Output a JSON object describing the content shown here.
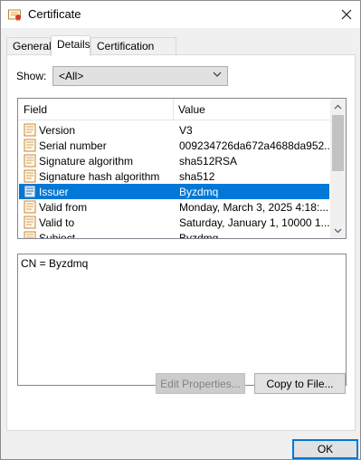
{
  "window": {
    "title": "Certificate"
  },
  "tabs": [
    {
      "label": "General"
    },
    {
      "label": "Details"
    },
    {
      "label": "Certification Path"
    }
  ],
  "show": {
    "label": "Show:",
    "selected": "<All>"
  },
  "list": {
    "columns": {
      "field": "Field",
      "value": "Value"
    },
    "rows": [
      {
        "field": "Version",
        "value": "V3"
      },
      {
        "field": "Serial number",
        "value": "009234726da672a4688da952..."
      },
      {
        "field": "Signature algorithm",
        "value": "sha512RSA"
      },
      {
        "field": "Signature hash algorithm",
        "value": "sha512"
      },
      {
        "field": "Issuer",
        "value": "Byzdmq"
      },
      {
        "field": "Valid from",
        "value": "Monday, March 3, 2025 4:18:..."
      },
      {
        "field": "Valid to",
        "value": "Saturday, January 1, 10000 1..."
      },
      {
        "field": "Subject",
        "value": "Byzdmq"
      }
    ],
    "selected_index": 4
  },
  "detail_value": "CN = Byzdmq",
  "buttons": {
    "edit_properties": "Edit Properties...",
    "copy_to_file": "Copy to File...",
    "ok": "OK"
  },
  "colors": {
    "selection": "#0078d7",
    "focus_border": "#0078d7"
  }
}
